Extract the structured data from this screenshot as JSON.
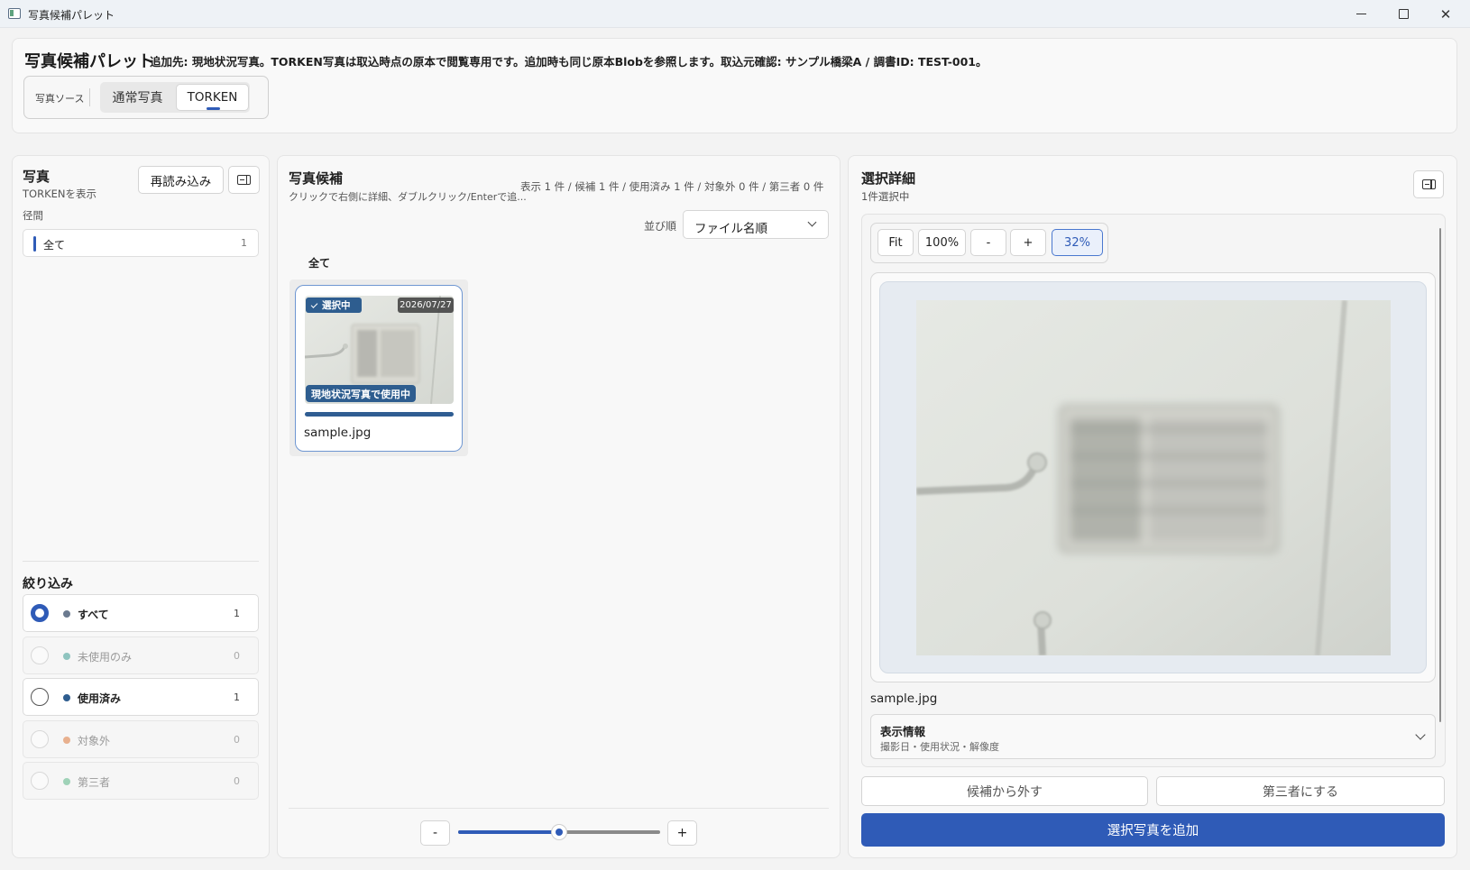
{
  "window": {
    "title": "写真候補パレット"
  },
  "header": {
    "title": "写真候補パレット",
    "note": "追加先: 現地状況写真。TORKEN写真は取込時点の原本で閲覧専用です。追加時も同じ原本Blobを参照します。取込元確認: サンプル橋梁A / 調書ID: TEST-001。",
    "source_label": "写真ソース",
    "sources": [
      {
        "label": "通常写真",
        "selected": false
      },
      {
        "label": "TORKEN",
        "selected": true
      }
    ]
  },
  "left_panel": {
    "title": "写真",
    "subtitle": "TORKENを表示",
    "reload_label": "再読み込み",
    "span_heading": "径間",
    "spans": [
      {
        "label": "全て",
        "count": "1"
      }
    ],
    "filter_heading": "絞り込み",
    "filters": [
      {
        "label": "すべて",
        "count": "1",
        "color": "#6b7a8f",
        "selected": true,
        "enabled": true
      },
      {
        "label": "未使用のみ",
        "count": "0",
        "color": "#8fc4bf",
        "selected": false,
        "enabled": false
      },
      {
        "label": "使用済み",
        "count": "1",
        "color": "#2e5d8f",
        "selected": false,
        "enabled": true
      },
      {
        "label": "対象外",
        "count": "0",
        "color": "#e8b08e",
        "selected": false,
        "enabled": false
      },
      {
        "label": "第三者",
        "count": "0",
        "color": "#9fd2b8",
        "selected": false,
        "enabled": false
      }
    ]
  },
  "middle_panel": {
    "title": "写真候補",
    "subtitle": "クリックで右側に詳細、ダブルクリック/Enterで追...",
    "stats": "表示 1 件 / 候補 1 件 / 使用済み 1 件 / 対象外 0 件 / 第三者 0 件",
    "sort_label": "並び順",
    "sort_value": "ファイル名順",
    "group_label": "全て",
    "photos": [
      {
        "file_name": "sample.jpg",
        "selected_badge": "選択中",
        "date": "2026/07/27",
        "usage_badge": "現地状況写真で使用中"
      }
    ],
    "zoom_minus": "-",
    "zoom_plus": "+",
    "thumbnail_zoom": 0.5
  },
  "right_panel": {
    "title": "選択詳細",
    "subtitle": "1件選択中",
    "zoom_buttons": {
      "fit": "Fit",
      "actual": "100%",
      "minus": "-",
      "plus": "+",
      "current": "32%"
    },
    "file_name": "sample.jpg",
    "info_title": "表示情報",
    "info_subtitle": "撮影日・使用状況・解像度",
    "remove_label": "候補から外す",
    "third_party_label": "第三者にする",
    "add_label": "選択写真を追加"
  },
  "colors": {
    "accent": "#2f5bb7",
    "badge": "#2e5d8f"
  }
}
